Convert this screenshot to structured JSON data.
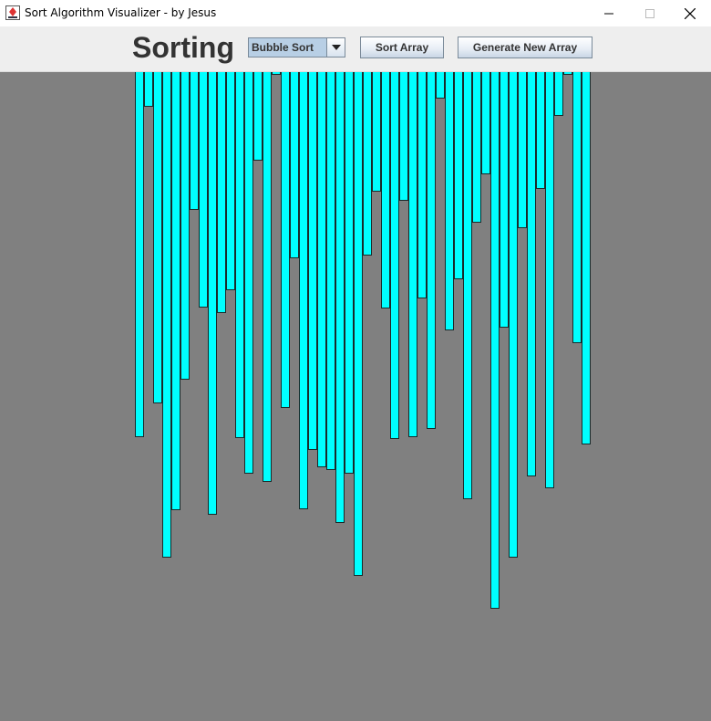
{
  "window": {
    "title": "Sort Algorithm Visualizer - by Jesus",
    "controls": [
      "minimize",
      "maximize",
      "close"
    ]
  },
  "toolbar": {
    "heading": "Sorting",
    "algorithm_select": {
      "selected": "Bubble Sort"
    },
    "sort_button_label": "Sort Array",
    "generate_button_label": "Generate New Array"
  },
  "colors": {
    "bar_fill": "#00ffff",
    "bar_border": "#1a2a2a",
    "canvas_bg": "#808080"
  },
  "bar_values": [
    400,
    38,
    363,
    532,
    480,
    337,
    151,
    258,
    485,
    264,
    239,
    401,
    440,
    97,
    449,
    3,
    368,
    204,
    479,
    414,
    433,
    436,
    494,
    440,
    552,
    201,
    131,
    259,
    402,
    141,
    400,
    248,
    391,
    29,
    283,
    227,
    468,
    165,
    112,
    588,
    280,
    532,
    171,
    443,
    128,
    456,
    48,
    3,
    297,
    408
  ]
}
